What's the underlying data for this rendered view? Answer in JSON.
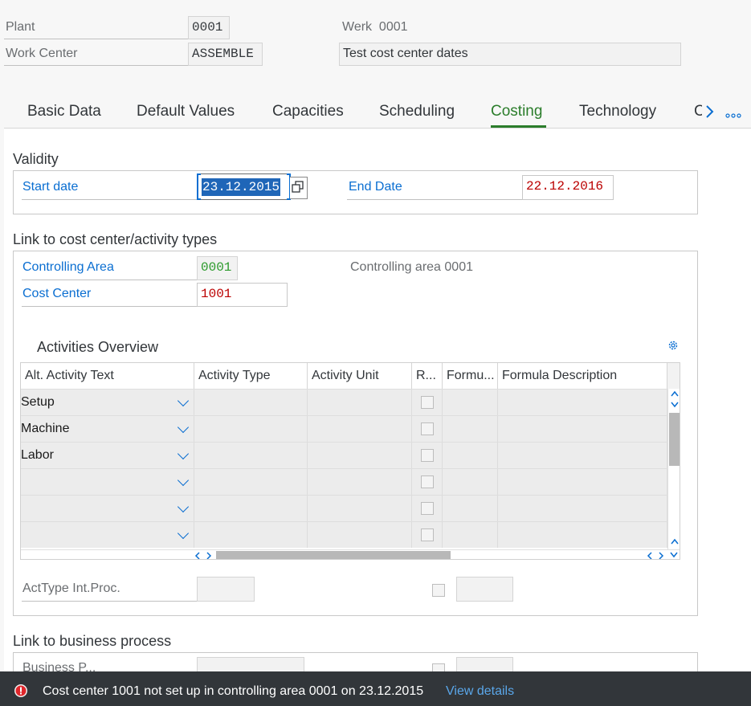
{
  "header": {
    "plant_label": "Plant",
    "plant_value": "0001",
    "plant_desc": "Werk  0001",
    "workcenter_label": "Work Center",
    "workcenter_value": "ASSEMBLE",
    "workcenter_desc": "Test cost center dates"
  },
  "tabs": [
    {
      "label": "Basic Data"
    },
    {
      "label": "Default Values"
    },
    {
      "label": "Capacities"
    },
    {
      "label": "Scheduling"
    },
    {
      "label": "Costing",
      "active": true
    },
    {
      "label": "Technology"
    },
    {
      "label": "C"
    }
  ],
  "validity": {
    "title": "Validity",
    "start_label": "Start date",
    "start_value": "23.12.2015",
    "end_label": "End Date",
    "end_value": "22.12.2016"
  },
  "link_cc": {
    "title": "Link to cost center/activity types",
    "ca_label": "Controlling Area",
    "ca_value": "0001",
    "ca_desc": "Controlling area 0001",
    "cc_label": "Cost Center",
    "cc_value": "1001"
  },
  "activities": {
    "title": "Activities Overview",
    "columns": [
      "Alt. Activity Text",
      "Activity Type",
      "Activity Unit",
      "R...",
      "Formu...",
      "Formula Description"
    ],
    "rows": [
      {
        "text": "Setup"
      },
      {
        "text": "Machine"
      },
      {
        "text": "Labor"
      },
      {
        "text": ""
      },
      {
        "text": ""
      },
      {
        "text": ""
      }
    ]
  },
  "acttype_label": "ActType Int.Proc.",
  "link_bp": {
    "title": "Link to business process",
    "bp_label": "Business P..."
  },
  "message": {
    "text": "Cost center 1001 not set up in controlling area 0001 on 23.12.2015",
    "link": "View details"
  },
  "colors": {
    "accent": "#0a6ed1",
    "active_tab": "#2b7d2b",
    "error": "#bb0000",
    "green_value": "#2b7d2b",
    "msgbar": "#32363a"
  }
}
